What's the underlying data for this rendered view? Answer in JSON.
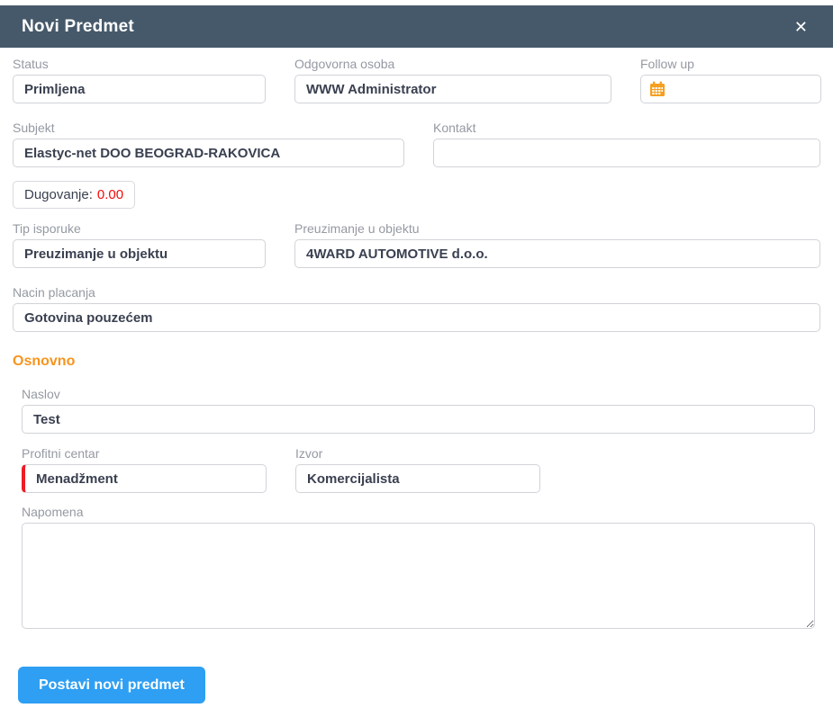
{
  "modal": {
    "title": "Novi Predmet",
    "close_glyph": "✕"
  },
  "form": {
    "status": {
      "label": "Status",
      "value": "Primljena"
    },
    "odgovorna_osoba": {
      "label": "Odgovorna osoba",
      "value": "WWW Administrator"
    },
    "follow_up": {
      "label": "Follow up",
      "value": "",
      "icon": "calendar-icon"
    },
    "subjekt": {
      "label": "Subjekt",
      "value": "Elastyc-net DOO BEOGRAD-RAKOVICA"
    },
    "kontakt": {
      "label": "Kontakt",
      "value": ""
    },
    "dugovanje": {
      "label": "Dugovanje:",
      "value": "0.00"
    },
    "tip_isporuke": {
      "label": "Tip isporuke",
      "value": "Preuzimanje u objektu"
    },
    "preuzimanje_u_objektu": {
      "label": "Preuzimanje u objektu",
      "value": "4WARD AUTOMOTIVE d.o.o."
    },
    "nacin_placanja": {
      "label": "Nacin placanja",
      "value": "Gotovina pouzećem"
    },
    "naslov": {
      "label": "Naslov",
      "value": "Test"
    },
    "profitni_centar": {
      "label": "Profitni centar",
      "value": "Menadžment",
      "state": "invalid"
    },
    "izvor": {
      "label": "Izvor",
      "value": "Komercijalista"
    },
    "napomena": {
      "label": "Napomena",
      "value": ""
    }
  },
  "sections": {
    "osnovno": "Osnovno"
  },
  "actions": {
    "submit_label": "Postavi novi predmet"
  },
  "colors": {
    "header_bg": "#46596a",
    "accent_orange": "#f7941e",
    "danger_red": "#f40b0b",
    "required_border_red": "#ee1c25",
    "primary_blue": "#2e9ff3",
    "label_gray": "#9599a2",
    "input_border": "#d1d3d8"
  }
}
